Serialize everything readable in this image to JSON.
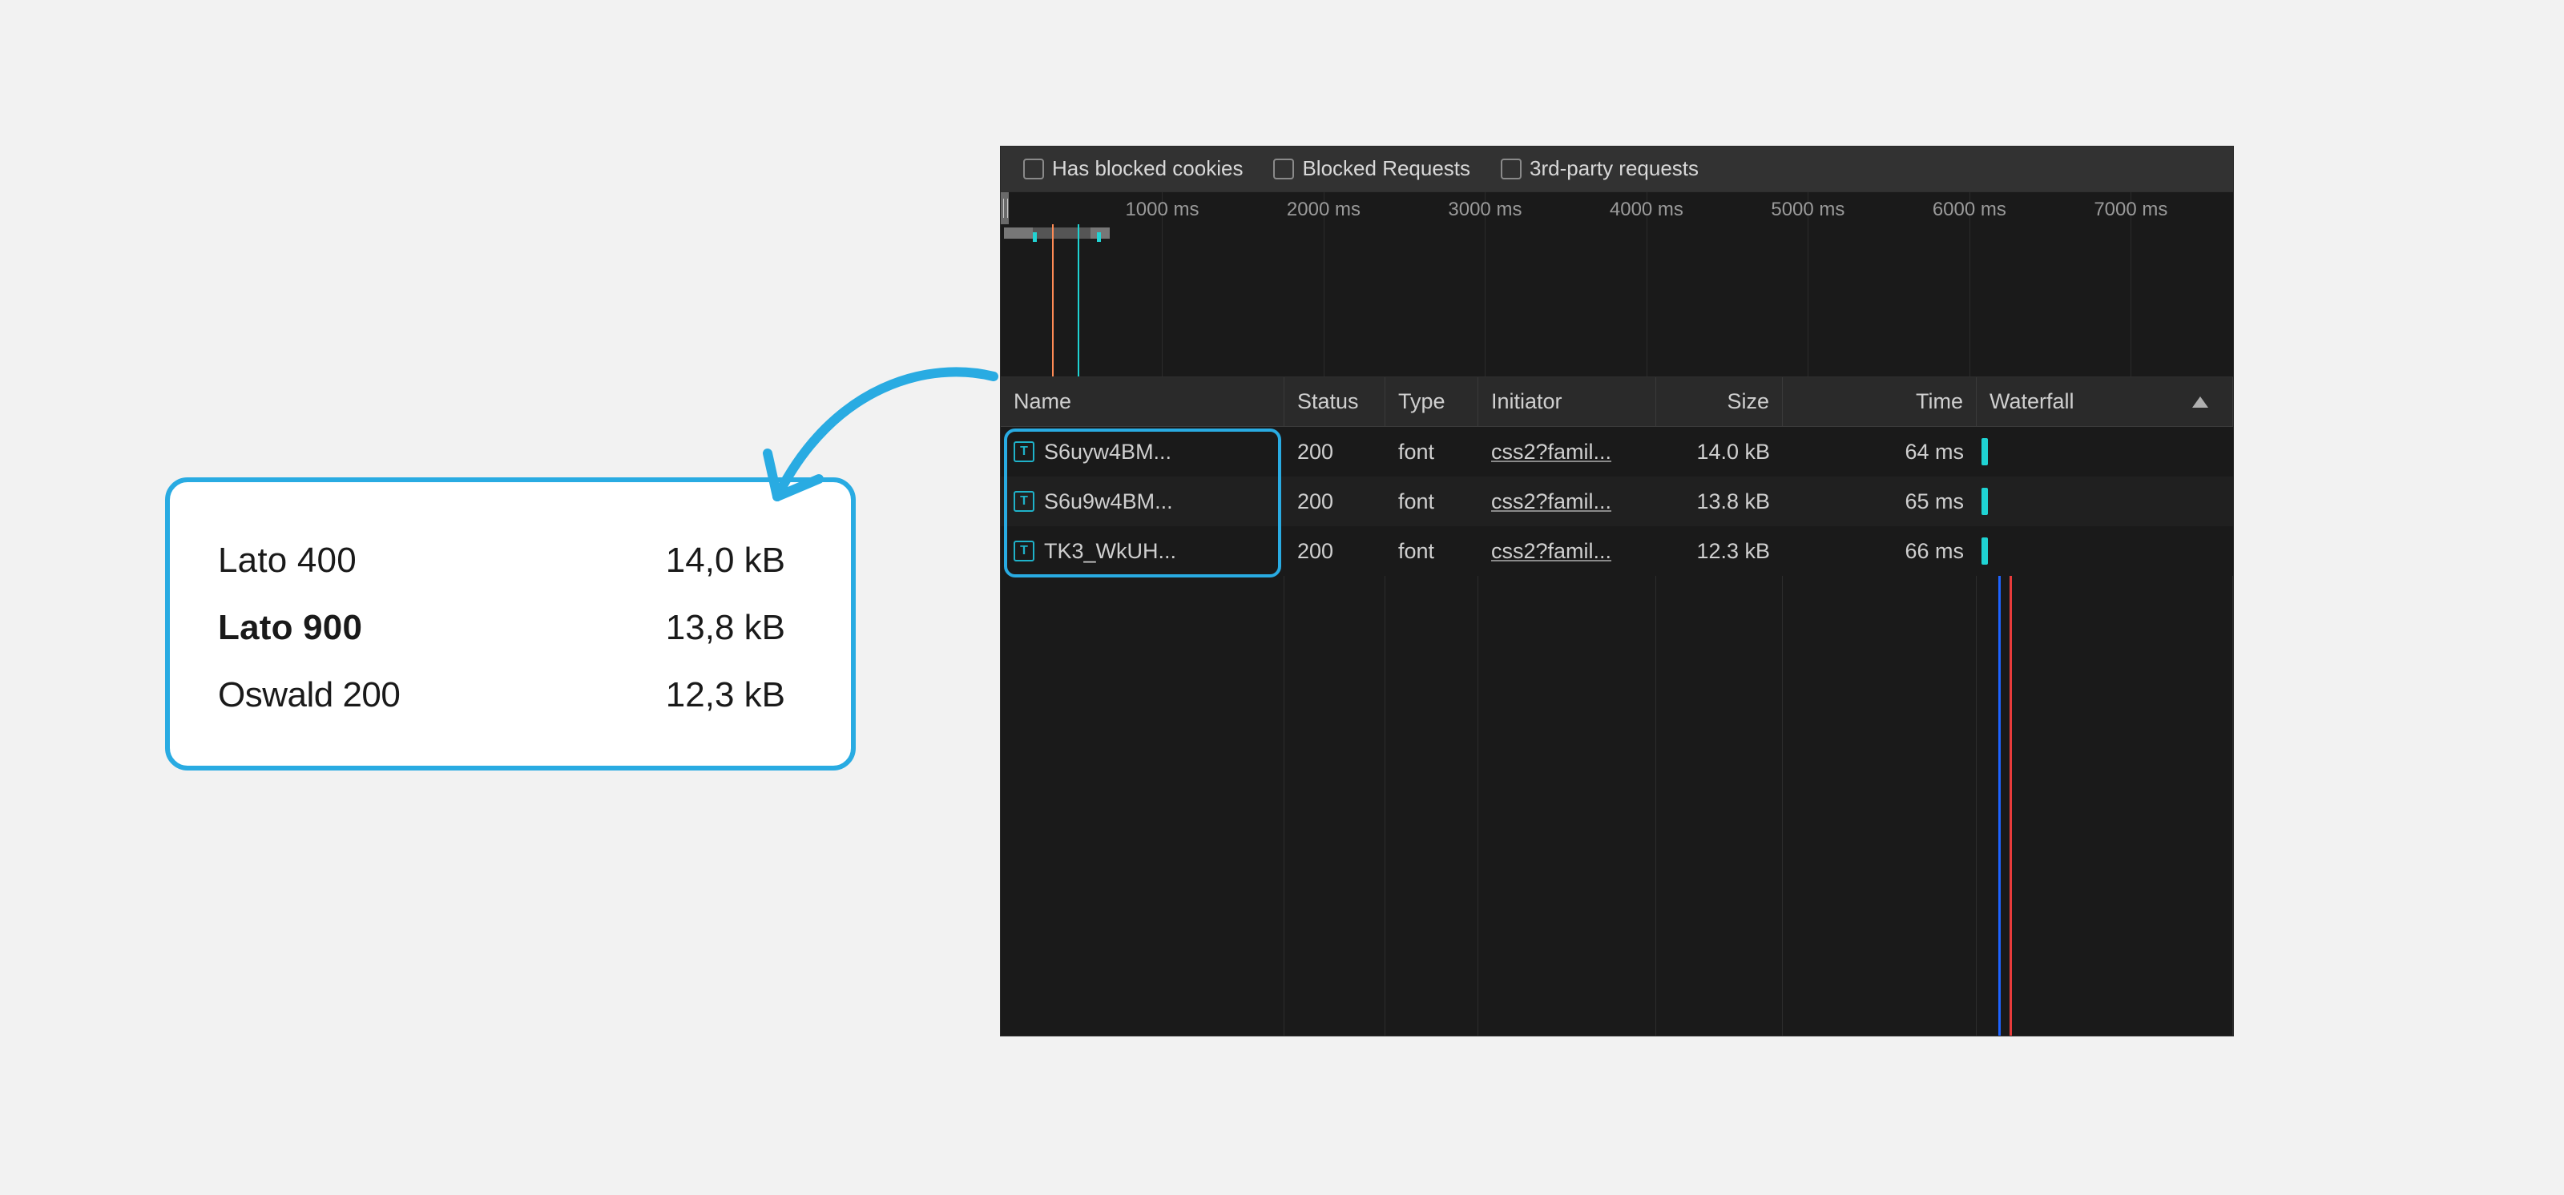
{
  "callout": {
    "rows": [
      {
        "name": "Lato 400",
        "size": "14,0 kB",
        "weight": "w400"
      },
      {
        "name": "Lato 900",
        "size": "13,8 kB",
        "weight": "w900"
      },
      {
        "name": "Oswald 200",
        "size": "12,3 kB",
        "weight": "wcond"
      }
    ]
  },
  "filters": {
    "blocked_cookies": "Has blocked cookies",
    "blocked_requests": "Blocked Requests",
    "third_party": "3rd-party requests"
  },
  "overview": {
    "ticks": [
      "1000 ms",
      "2000 ms",
      "3000 ms",
      "4000 ms",
      "5000 ms",
      "6000 ms",
      "7000 ms"
    ],
    "tick_pct": [
      13.1,
      26.2,
      39.3,
      52.4,
      65.5,
      78.6,
      91.7
    ]
  },
  "columns": {
    "name": "Name",
    "status": "Status",
    "type": "Type",
    "initiator": "Initiator",
    "size": "Size",
    "time": "Time",
    "waterfall": "Waterfall"
  },
  "rows": [
    {
      "name": "S6uyw4BM...",
      "status": "200",
      "type": "font",
      "initiator": "css2?famil...",
      "size": "14.0 kB",
      "time": "64 ms"
    },
    {
      "name": "S6u9w4BM...",
      "status": "200",
      "type": "font",
      "initiator": "css2?famil...",
      "size": "13.8 kB",
      "time": "65 ms"
    },
    {
      "name": "TK3_WkUH...",
      "status": "200",
      "type": "font",
      "initiator": "css2?famil...",
      "size": "12.3 kB",
      "time": "66 ms"
    }
  ],
  "colors": {
    "accent": "#29abe2"
  }
}
